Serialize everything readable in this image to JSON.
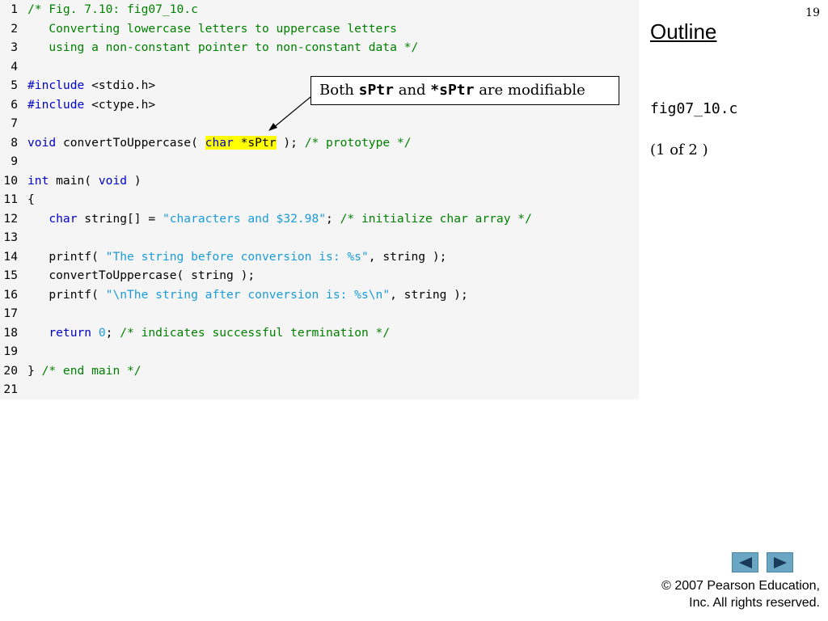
{
  "slide": {
    "number": "19",
    "outline_title": "Outline",
    "filename": "fig07_10.c",
    "page_of": "(1 of 2 )",
    "copyright_line1": "© 2007 Pearson Education,",
    "copyright_line2": "Inc.  All rights reserved."
  },
  "callout": {
    "pre": "Both ",
    "code1": "sPtr",
    "mid": " and ",
    "code2": "*sPtr",
    "post": " are modifiable"
  },
  "navigation": {
    "prev_icon": "left-triangle",
    "next_icon": "right-triangle"
  },
  "code": [
    {
      "n": "1",
      "tokens": [
        {
          "t": "/* Fig. 7.10: fig07_10.c",
          "c": "cmt"
        }
      ]
    },
    {
      "n": "2",
      "tokens": [
        {
          "t": "   Converting lowercase letters to uppercase letters",
          "c": "cmt"
        }
      ]
    },
    {
      "n": "3",
      "tokens": [
        {
          "t": "   using a non-constant pointer to non-constant data */",
          "c": "cmt"
        }
      ]
    },
    {
      "n": "4",
      "tokens": []
    },
    {
      "n": "5",
      "tokens": [
        {
          "t": "#include",
          "c": "pp"
        },
        {
          "t": " <stdio.h>",
          "c": ""
        }
      ]
    },
    {
      "n": "6",
      "tokens": [
        {
          "t": "#include",
          "c": "pp"
        },
        {
          "t": " <ctype.h>",
          "c": ""
        }
      ]
    },
    {
      "n": "7",
      "tokens": []
    },
    {
      "n": "8",
      "tokens": [
        {
          "t": "void",
          "c": "kw"
        },
        {
          "t": " convertToUppercase( ",
          "c": ""
        },
        {
          "t": "char",
          "c": "hl"
        },
        {
          "t": " *sPtr",
          "c": "hl2"
        },
        {
          "t": " ); ",
          "c": ""
        },
        {
          "t": "/* prototype */",
          "c": "cmt"
        }
      ]
    },
    {
      "n": "9",
      "tokens": []
    },
    {
      "n": "10",
      "tokens": [
        {
          "t": "int",
          "c": "kw"
        },
        {
          "t": " main( ",
          "c": ""
        },
        {
          "t": "void",
          "c": "kw"
        },
        {
          "t": " )",
          "c": ""
        }
      ]
    },
    {
      "n": "11",
      "tokens": [
        {
          "t": "{",
          "c": ""
        }
      ]
    },
    {
      "n": "12",
      "tokens": [
        {
          "t": "   ",
          "c": ""
        },
        {
          "t": "char",
          "c": "kw"
        },
        {
          "t": " string[] = ",
          "c": ""
        },
        {
          "t": "\"characters and $32.98\"",
          "c": "str"
        },
        {
          "t": "; ",
          "c": ""
        },
        {
          "t": "/* initialize char array */",
          "c": "cmt"
        }
      ]
    },
    {
      "n": "13",
      "tokens": []
    },
    {
      "n": "14",
      "tokens": [
        {
          "t": "   printf( ",
          "c": ""
        },
        {
          "t": "\"The string before conversion is: %s\"",
          "c": "str"
        },
        {
          "t": ", string );",
          "c": ""
        }
      ]
    },
    {
      "n": "15",
      "tokens": [
        {
          "t": "   convertToUppercase( string );",
          "c": ""
        }
      ]
    },
    {
      "n": "16",
      "tokens": [
        {
          "t": "   printf( ",
          "c": ""
        },
        {
          "t": "\"\\nThe string after conversion is: %s\\n\"",
          "c": "str"
        },
        {
          "t": ", string );",
          "c": ""
        }
      ]
    },
    {
      "n": "17",
      "tokens": []
    },
    {
      "n": "18",
      "tokens": [
        {
          "t": "   ",
          "c": ""
        },
        {
          "t": "return",
          "c": "kw"
        },
        {
          "t": " ",
          "c": ""
        },
        {
          "t": "0",
          "c": "str"
        },
        {
          "t": "; ",
          "c": ""
        },
        {
          "t": "/* indicates successful termination */",
          "c": "cmt"
        }
      ]
    },
    {
      "n": "19",
      "tokens": []
    },
    {
      "n": "20",
      "tokens": [
        {
          "t": "} ",
          "c": ""
        },
        {
          "t": "/* end main */",
          "c": "cmt"
        }
      ]
    },
    {
      "n": "21",
      "tokens": []
    }
  ]
}
